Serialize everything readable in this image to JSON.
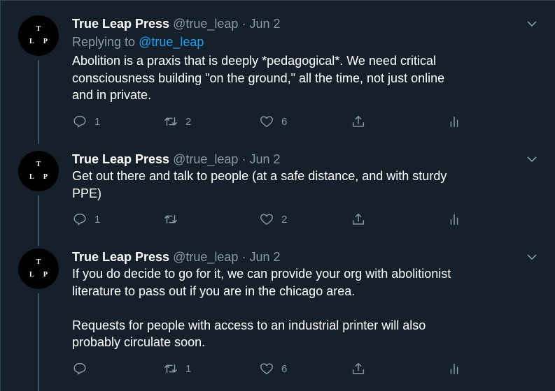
{
  "tweets": [
    {
      "author_name": "True Leap Press",
      "handle": "@true_leap",
      "separator": "·",
      "date": "Jun 2",
      "replying_prefix": "Replying to ",
      "replying_to": "@true_leap",
      "text": "Abolition is a praxis that is deeply *pedagogical*. We need critical\nconsciousness building \"on the ground,\" all the time, not just online\nand in private.",
      "replies": "1",
      "retweets": "2",
      "likes": "6"
    },
    {
      "author_name": "True Leap Press",
      "handle": "@true_leap",
      "separator": "·",
      "date": "Jun 2",
      "text": "Get out there and talk to people (at a safe distance, and with sturdy\nPPE)",
      "replies": "1",
      "retweets": "",
      "likes": "2"
    },
    {
      "author_name": "True Leap Press",
      "handle": "@true_leap",
      "separator": "·",
      "date": "Jun 2",
      "text": "If you do decide to go for it, we can provide your org with abolitionist\nliterature to pass out if you are in the chicago area.\n\nRequests for people with access to an industrial printer will also\nprobably circulate soon.",
      "replies": "",
      "retweets": "1",
      "likes": "6"
    }
  ],
  "avatar": {
    "top": "T",
    "left": "L",
    "right": "P"
  },
  "colors": {
    "background": "#15202b",
    "muted": "#8899a6",
    "link": "#1da1f2",
    "border": "#38444d"
  },
  "icons": [
    "reply-icon",
    "retweet-icon",
    "like-icon",
    "share-icon",
    "analytics-icon",
    "chevron-down-icon"
  ]
}
